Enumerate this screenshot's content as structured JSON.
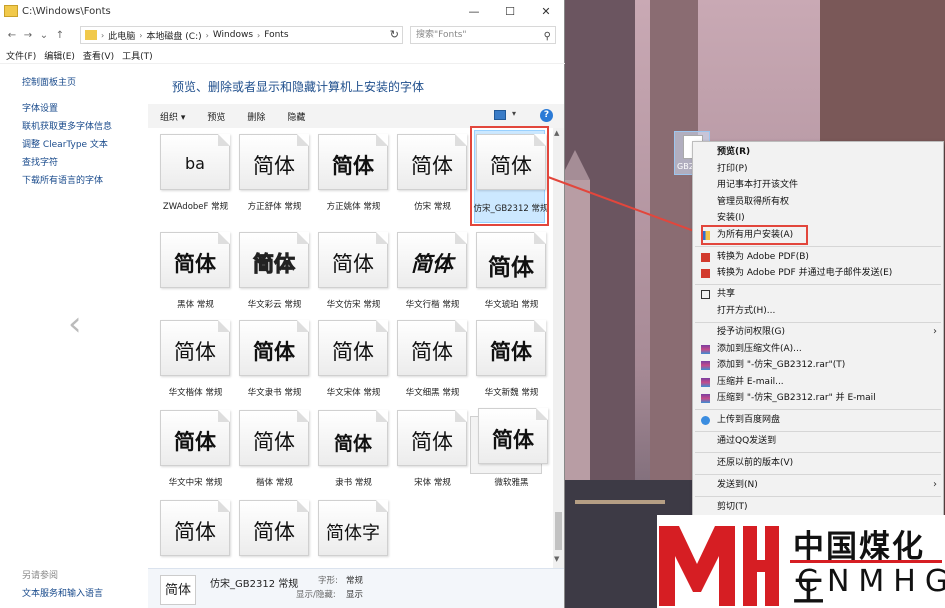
{
  "window": {
    "title": "C:\\Windows\\Fonts",
    "controls": [
      "—",
      "☐",
      "✕"
    ]
  },
  "address": {
    "crumbs": [
      "此电脑",
      "本地磁盘 (C:)",
      "Windows",
      "Fonts"
    ],
    "search_placeholder": "搜索\"Fonts\""
  },
  "menu": [
    "文件(F)",
    "编辑(E)",
    "查看(V)",
    "工具(T)"
  ],
  "left_pane": {
    "home": "控制面板主页",
    "links": [
      "字体设置",
      "联机获取更多字体信息",
      "调整 ClearType 文本",
      "查找字符",
      "下载所有语言的字体"
    ],
    "see_also_title": "另请参阅",
    "see_also": [
      "文本服务和输入语言"
    ]
  },
  "page_title": "预览、删除或者显示和隐藏计算机上安装的字体",
  "commands": [
    "组织 ▾",
    "预览",
    "删除",
    "隐藏"
  ],
  "fonts": [
    {
      "sample": "ba",
      "label": "ZWAdobeF 常规"
    },
    {
      "sample": "简体",
      "label": "方正舒体 常规"
    },
    {
      "sample": "简体",
      "label": "方正姚体 常规"
    },
    {
      "sample": "简体",
      "label": "仿宋 常规"
    },
    {
      "sample": "简体",
      "label": "仿宋_GB2312 常规"
    },
    {
      "sample": "简体",
      "label": "黑体 常规"
    },
    {
      "sample": "简体",
      "label": "华文彩云 常规"
    },
    {
      "sample": "简体",
      "label": "华文仿宋 常规"
    },
    {
      "sample": "简体",
      "label": "华文行楷 常规"
    },
    {
      "sample": "简体",
      "label": "华文琥珀 常规"
    },
    {
      "sample": "简体",
      "label": "华文楷体 常规"
    },
    {
      "sample": "简体",
      "label": "华文隶书 常规"
    },
    {
      "sample": "简体",
      "label": "华文宋体 常规"
    },
    {
      "sample": "简体",
      "label": "华文细黑 常规"
    },
    {
      "sample": "简体",
      "label": "华文新魏 常规"
    },
    {
      "sample": "简体",
      "label": "华文中宋 常规"
    },
    {
      "sample": "简体",
      "label": "楷体 常规"
    },
    {
      "sample": "简体",
      "label": "隶书 常规"
    },
    {
      "sample": "简体",
      "label": "宋体 常规"
    },
    {
      "sample": "简体",
      "label": "微软雅黑"
    },
    {
      "sample": "简体",
      "label": ""
    },
    {
      "sample": "简体",
      "label": ""
    },
    {
      "sample": "简体字",
      "label": ""
    }
  ],
  "details": {
    "sample": "简体",
    "name": "仿宋_GB2312 常规",
    "style_key": "字形:",
    "style_val": "常规",
    "visibility_key": "显示/隐藏:",
    "visibility_val": "显示"
  },
  "desktop_icon_caption": "GB2",
  "context_menu": {
    "items": [
      "预览(R)",
      "打印(P)",
      "用记事本打开该文件",
      "管理员取得所有权",
      "安装(I)",
      "为所有用户安装(A)",
      "转换为 Adobe PDF(B)",
      "转换为 Adobe PDF 并通过电子邮件发送(E)",
      "共享",
      "打开方式(H)...",
      "授予访问权限(G)",
      "添加到压缩文件(A)...",
      "添加到 \"-仿宋_GB2312.rar\"(T)",
      "压缩并 E-mail...",
      "压缩到 \"-仿宋_GB2312.rar\" 并 E-mail",
      "上传到百度网盘",
      "通过QQ发送到",
      "还原以前的版本(V)",
      "发送到(N)",
      "剪切(T)"
    ]
  },
  "watermark": {
    "cn": "中国煤化工",
    "en": "CNMHG"
  },
  "colors": {
    "highlight_red": "#e2463c",
    "link_blue": "#1a4b8c",
    "title_blue": "#1e4e8c",
    "watermark_red": "#d61e23"
  }
}
